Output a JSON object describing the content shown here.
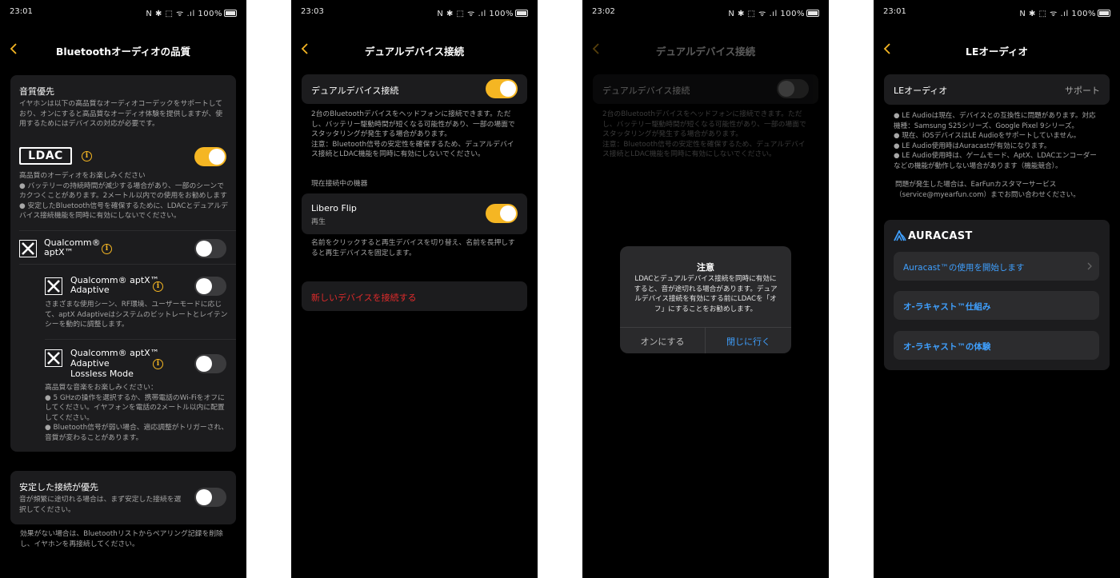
{
  "status_bars": [
    {
      "time": "23:01",
      "icons": "N ✱ ⬚ ᯤ .ıl",
      "battery": "100%"
    },
    {
      "time": "23:03",
      "icons": "N ✱ ⬚ ᯤ .ıl",
      "battery": "100%"
    },
    {
      "time": "23:02",
      "icons": "N ✱ ⬚ ᯤ .ıl",
      "battery": "100%"
    },
    {
      "time": "23:01",
      "icons": "N ✱ ⬚ ᯤ .ıl",
      "battery": "100%"
    }
  ],
  "colors": {
    "accent": "#f5b623",
    "card": "#1c1c1e",
    "danger": "#e02b2b",
    "link": "#3fa0ff"
  },
  "screen1": {
    "title": "Bluetoothオーディオの品質",
    "sound_priority": {
      "heading": "音質優先",
      "desc_lines": [
        "イヤホンは以下の高品質なオーディオコーデックをサポートして",
        "おり、オンにすると高品質なオーディオ体験を提供しますが、使",
        "用するためにはデバイスの対応が必要です。"
      ]
    },
    "ldac": {
      "logo": "LDAC",
      "toggle": "on",
      "desc_lines": [
        "高品質のオーディオをお楽しみください",
        "● バッテリーの持続時間が減少する場合があり、一部のシーンで",
        "カクつくことがあります。2メートル以内での使用をお勧めします",
        "● 安定したBluetooth信号を確保するために、LDACとデュアルデ",
        "バイス接続機能を同時に有効にしないでください。"
      ]
    },
    "aptx": {
      "line1": "Qualcomm®",
      "line2": "aptX™",
      "toggle": "off"
    },
    "aptx_adaptive": {
      "line1": "Qualcomm® aptX™",
      "line2": "Adaptive",
      "toggle": "off",
      "desc_lines": [
        "さまざまな使用シーン、RF環境、ユーザーモードに応じ",
        "て、aptX Adaptiveはシステムのビットレートとレイテン",
        "シーを動的に調整します。"
      ]
    },
    "aptx_lossless": {
      "line1": "Qualcomm® aptX™",
      "line2": "Adaptive",
      "line3": "Lossless Mode",
      "toggle": "off",
      "desc_lines": [
        "高品質な音楽をお楽しみください：",
        "● 5 GHzの操作を選択するか、携帯電話のWi-Fiをオフに",
        "してください。イヤフォンを電話の2メートル以内に配置",
        "してください。",
        "● Bluetooth信号が弱い場合、適応調整がトリガーされ、",
        "音質が変わることがあります。"
      ]
    },
    "stable": {
      "heading": "安定した接続が優先",
      "toggle": "off",
      "desc_lines": [
        "音が頻繁に途切れる場合は、まず安定した接続を選",
        "択してください。"
      ]
    },
    "footer_lines": [
      "効果がない場合は、Bluetoothリストからペアリング記録を削除",
      "し、イヤホンを再接続してください。"
    ]
  },
  "screen2": {
    "title": "デュアルデバイス接続",
    "dual": {
      "label": "デュアルデバイス接続",
      "toggle": "on"
    },
    "desc_lines": [
      "2台のBluetoothデバイスをヘッドフォンに接続できます。ただ",
      "し、バッテリー駆動時間が短くなる可能性があり、一部の場面で",
      "スタッタリングが発生する場合があります。",
      "注意：Bluetooth信号の安定性を確保するため、デュアルデバイ",
      "ス接続とLDAC機能を同時に有効にしないでください。"
    ],
    "section_label": "現在接続中の機器",
    "device": {
      "name": "Libero Flip",
      "status": "再生",
      "toggle": "on"
    },
    "hint_lines": [
      "名前をクリックすると再生デバイスを切り替え、名前を長押しす",
      "ると再生デバイスを固定します。"
    ],
    "connect_new": "新しいデバイスを接続する"
  },
  "screen3": {
    "title": "デュアルデバイス接続",
    "dual": {
      "label": "デュアルデバイス接続",
      "toggle": "off"
    },
    "desc_lines": [
      "2台のBluetoothデバイスをヘッドフォンに接続できます。ただ",
      "し、バッテリー駆動時間が短くなる可能性があり、一部の場面で",
      "スタッタリングが発生する場合があります。",
      "注意：Bluetooth信号の安定性を確保するため、デュアルデバイ",
      "ス接続とLDAC機能を同時に有効にしないでください。"
    ],
    "dialog": {
      "title": "注意",
      "body_lines": [
        "LDACとデュアルデバイス接続を同時に有効に",
        "すると、音が途切れる場合があります。デュア",
        "ルデバイス接続を有効にする前にLDACを「オ",
        "フ」にすることをお勧めします。"
      ],
      "cancel": "オンにする",
      "confirm": "閉じに行く"
    }
  },
  "screen4": {
    "title": "LEオーディオ",
    "le": {
      "label": "LEオーディオ",
      "value": "サポート"
    },
    "notes_lines": [
      "● LE Audioは現在、デバイスとの互換性に問題があります。対応",
      "機種：Samsung S25シリーズ、Google Pixel 9シリーズ。",
      "● 現在、iOSデバイスはLE Audioをサポートしていません。",
      "● LE Audio使用時はAuracastが有効になります。",
      "● LE Audio使用時は、ゲームモード、AptX、LDACエンコーダー",
      "などの機能が動作しない場合があります（機能競合）。"
    ],
    "contact_lines": [
      "問題が発生した場合は、EarFunカスタマーサービス",
      "（service@myearfun.com）までお問い合わせください。"
    ],
    "auracast": {
      "brand": "AURACAST",
      "start": "Auracast™の使用を開始します",
      "how": "オ-ラキャスト™仕組み",
      "experience": "オ-ラキャスト™の体験"
    }
  }
}
